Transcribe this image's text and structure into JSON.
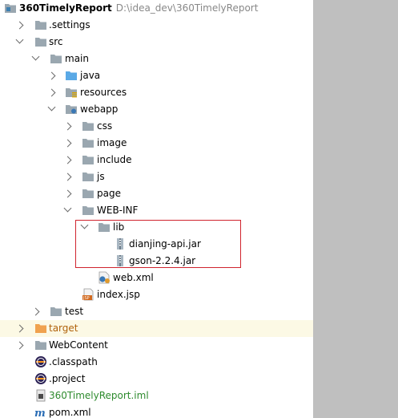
{
  "root": {
    "name": "360TimelyReport",
    "path": "D:\\idea_dev\\360TimelyReport"
  },
  "items": {
    "settings": ".settings",
    "src": "src",
    "main": "main",
    "java": "java",
    "resources": "resources",
    "webapp": "webapp",
    "css": "css",
    "image": "image",
    "include": "include",
    "js": "js",
    "page": "page",
    "webinf": "WEB-INF",
    "lib": "lib",
    "jar1": "dianjing-api.jar",
    "jar2": "gson-2.2.4.jar",
    "webxml": "web.xml",
    "indexjsp": "index.jsp",
    "test": "test",
    "target": "target",
    "webcontent": "WebContent",
    "classpath": ".classpath",
    "project": ".project",
    "iml": "360TimelyReport.iml",
    "pom": "pom.xml"
  },
  "colors": {
    "folder": "#9aa7b0",
    "source_folder": "#5aa9e6",
    "excluded_folder": "#f0a24f",
    "excluded_text": "#b0620b",
    "iml_text": "#2e8b2e",
    "selected_row": "#fcf9e5",
    "highlight_border": "#d0242e",
    "gutter": "#bfbfbf"
  },
  "icons": {
    "settings": "folder-icon",
    "src": "folder-icon",
    "main": "folder-icon",
    "java": "source-folder-icon",
    "resources": "resources-folder-icon",
    "webapp": "web-folder-icon",
    "css": "folder-icon",
    "image": "folder-icon",
    "include": "folder-icon",
    "js": "folder-icon",
    "page": "folder-icon",
    "webinf": "folder-icon",
    "lib": "folder-icon",
    "jar1": "jar-icon",
    "jar2": "jar-icon",
    "webxml": "xml-config-icon",
    "indexjsp": "jsp-file-icon",
    "test": "folder-icon",
    "target": "excluded-folder-icon",
    "webcontent": "folder-icon",
    "classpath": "eclipse-file-icon",
    "project": "eclipse-file-icon",
    "iml": "module-file-icon",
    "pom": "maven-icon"
  }
}
